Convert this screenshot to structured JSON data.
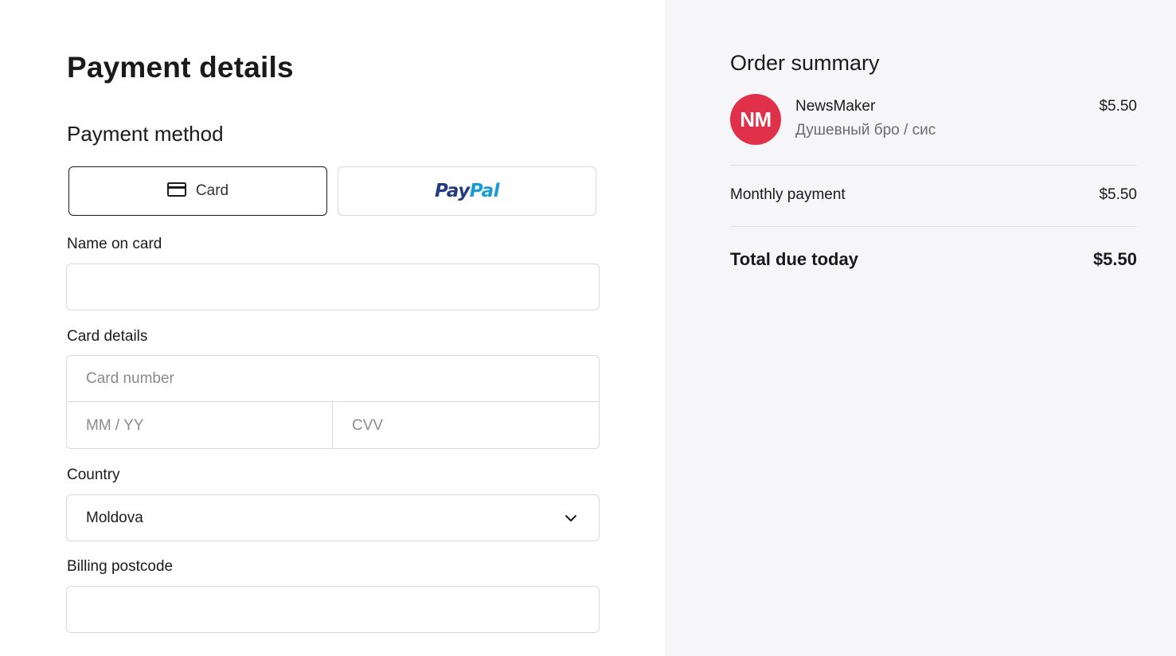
{
  "payment": {
    "title": "Payment details",
    "method_title": "Payment method",
    "methods": {
      "card_label": "Card",
      "paypal_pay": "Pay",
      "paypal_pal": "Pal"
    },
    "name_label": "Name on card",
    "name_value": "",
    "card_details_label": "Card details",
    "card_number_placeholder": "Card number",
    "expiry_placeholder": "MM / YY",
    "cvv_placeholder": "CVV",
    "country_label": "Country",
    "country_value": "Moldova",
    "postcode_label": "Billing postcode",
    "postcode_value": ""
  },
  "summary": {
    "title": "Order summary",
    "avatar_initials": "NM",
    "avatar_color": "#e0304a",
    "creator_name": "NewsMaker",
    "tier_name": "Душевный бро / сис",
    "item_price": "$5.50",
    "monthly_label": "Monthly payment",
    "monthly_price": "$5.50",
    "total_label": "Total due today",
    "total_price": "$5.50"
  },
  "colors": {
    "paypal_dark": "#253b80",
    "paypal_light": "#179bd7",
    "panel_bg": "#f6f6f8"
  }
}
